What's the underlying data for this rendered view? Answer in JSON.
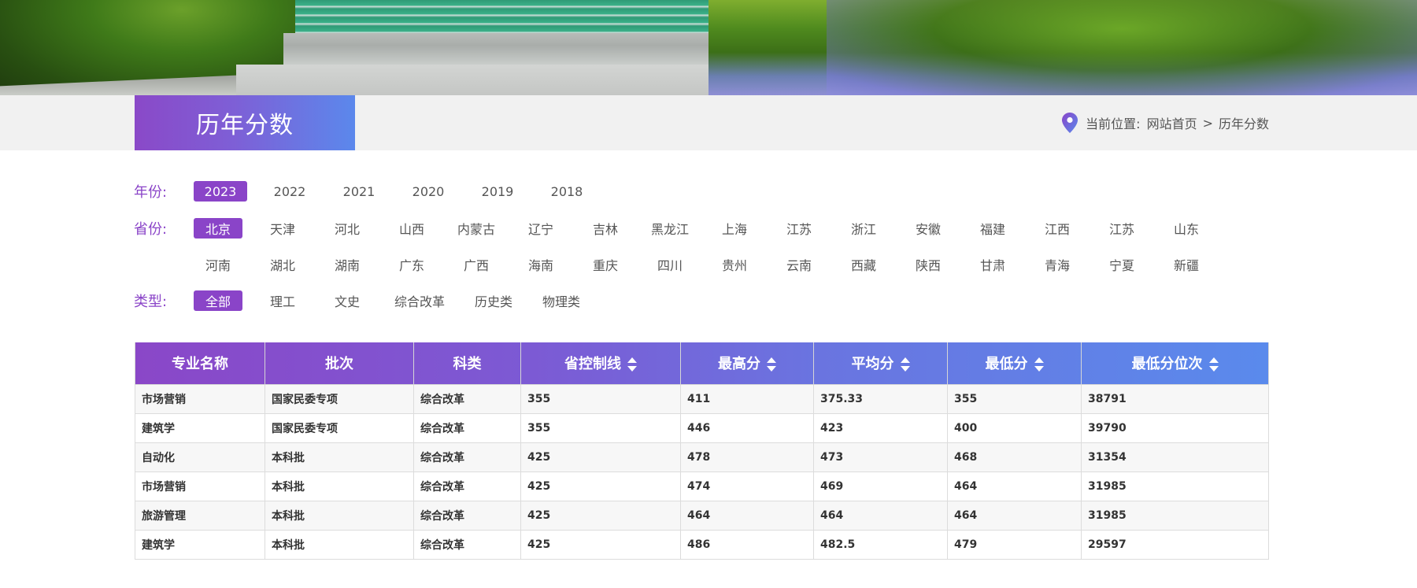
{
  "header": {
    "title": "历年分数",
    "location_label": "当前位置:",
    "breadcrumb": [
      {
        "label": "网站首页"
      },
      {
        "label": "历年分数"
      }
    ],
    "separator": ">",
    "location_icon": "map-pin-icon"
  },
  "filters": {
    "year": {
      "label": "年份:",
      "options": [
        "2023",
        "2022",
        "2021",
        "2020",
        "2019",
        "2018"
      ],
      "selected": "2023"
    },
    "province": {
      "label": "省份:",
      "options_row1": [
        "北京",
        "天津",
        "河北",
        "山西",
        "内蒙古",
        "辽宁",
        "吉林",
        "黑龙江",
        "上海",
        "江苏",
        "浙江",
        "安徽",
        "福建",
        "江西",
        "江苏",
        "山东"
      ],
      "options_row2": [
        "河南",
        "湖北",
        "湖南",
        "广东",
        "广西",
        "海南",
        "重庆",
        "四川",
        "贵州",
        "云南",
        "西藏",
        "陕西",
        "甘肃",
        "青海",
        "宁夏",
        "新疆"
      ],
      "selected": "北京"
    },
    "type": {
      "label": "类型:",
      "options": [
        "全部",
        "理工",
        "文史",
        "综合改革",
        "历史类",
        "物理类"
      ],
      "selected": "全部"
    }
  },
  "table": {
    "columns": [
      {
        "label": "专业名称",
        "sortable": false
      },
      {
        "label": "批次",
        "sortable": false
      },
      {
        "label": "科类",
        "sortable": false
      },
      {
        "label": "省控制线",
        "sortable": true
      },
      {
        "label": "最高分",
        "sortable": true
      },
      {
        "label": "平均分",
        "sortable": true
      },
      {
        "label": "最低分",
        "sortable": true
      },
      {
        "label": "最低分位次",
        "sortable": true
      }
    ],
    "rows": [
      [
        "市场营销",
        "国家民委专项",
        "综合改革",
        "355",
        "411",
        "375.33",
        "355",
        "38791"
      ],
      [
        "建筑学",
        "国家民委专项",
        "综合改革",
        "355",
        "446",
        "423",
        "400",
        "39790"
      ],
      [
        "自动化",
        "本科批",
        "综合改革",
        "425",
        "478",
        "473",
        "468",
        "31354"
      ],
      [
        "市场营销",
        "本科批",
        "综合改革",
        "425",
        "474",
        "469",
        "464",
        "31985"
      ],
      [
        "旅游管理",
        "本科批",
        "综合改革",
        "425",
        "464",
        "464",
        "464",
        "31985"
      ],
      [
        "建筑学",
        "本科批",
        "综合改革",
        "425",
        "486",
        "482.5",
        "479",
        "29597"
      ]
    ]
  },
  "colors": {
    "accent": "#8a44c8",
    "gradient_end": "#5a8aec"
  }
}
